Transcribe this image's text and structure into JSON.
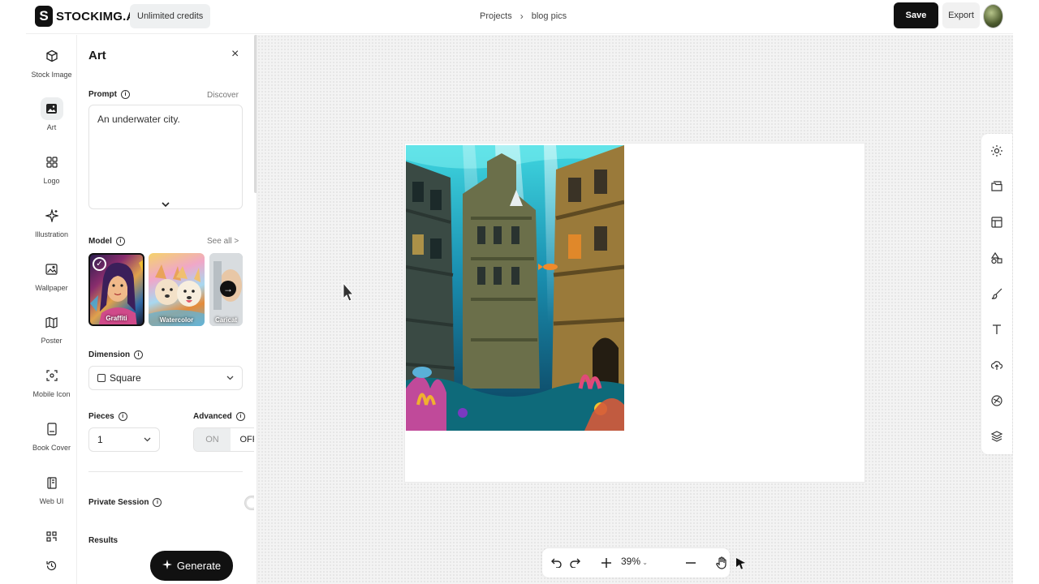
{
  "app": {
    "logo_mark": "S",
    "logo_text": "STOCKIMG.AI",
    "credits_badge": "Unlimited credits",
    "save_label": "Save",
    "export_label": "Export"
  },
  "breadcrumb": {
    "root": "Projects",
    "separator": "›",
    "current": "blog pics"
  },
  "rail": {
    "items": [
      {
        "label": "Stock Image",
        "icon": "cube-icon"
      },
      {
        "label": "Art",
        "icon": "image-icon"
      },
      {
        "label": "Logo",
        "icon": "grid-icon"
      },
      {
        "label": "Illustration",
        "icon": "sparkle-icon"
      },
      {
        "label": "Wallpaper",
        "icon": "wallpaper-icon"
      },
      {
        "label": "Poster",
        "icon": "map-icon"
      },
      {
        "label": "Mobile Icon",
        "icon": "mobile-icon"
      },
      {
        "label": "Book Cover",
        "icon": "book-icon"
      },
      {
        "label": "Web UI",
        "icon": "webui-icon"
      }
    ],
    "active": "Art"
  },
  "panel": {
    "title": "Art",
    "close_glyph": "×",
    "prompt_label": "Prompt",
    "discover_label": "Discover",
    "prompt_value": "An underwater city.",
    "model_label": "Model",
    "see_all_label": "See all >",
    "models": [
      {
        "name": "Graffiti",
        "selected": true
      },
      {
        "name": "Watercolor",
        "selected": false
      },
      {
        "name": "Caricat",
        "selected": false
      }
    ],
    "dimension_label": "Dimension",
    "dimension_value": "Square",
    "pieces_label": "Pieces",
    "pieces_value": "1",
    "advanced_label": "Advanced",
    "advanced_on": "ON",
    "advanced_off": "OFF",
    "private_label": "Private Session",
    "private_enabled": false,
    "results_label": "Results",
    "generate_label": "Generate"
  },
  "canvas": {
    "zoom": "39%",
    "image_subject": "underwater city"
  },
  "colors": {
    "primary": "#111111",
    "canvas_bg": "#f3f3f3",
    "accent_art": "#1fb3c8"
  }
}
